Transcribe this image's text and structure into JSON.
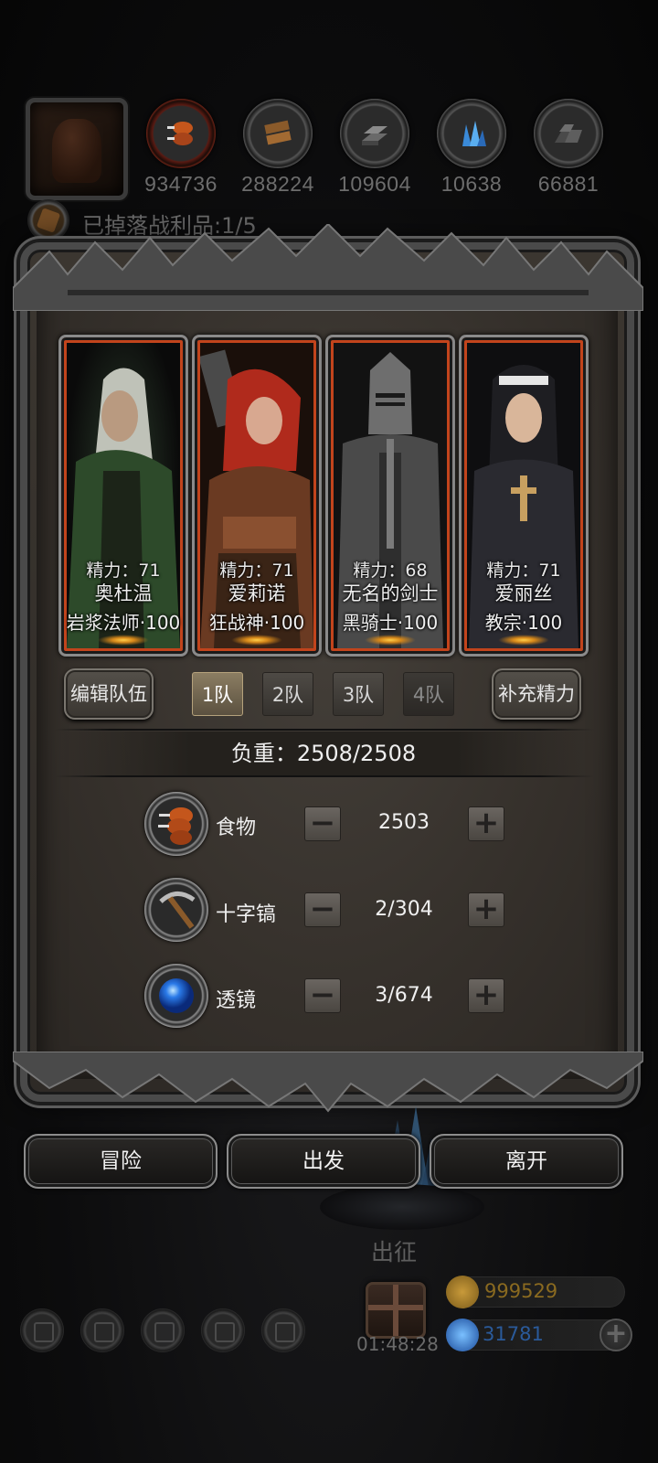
{
  "resources": [
    {
      "icon": "food-icon",
      "value": "934736"
    },
    {
      "icon": "wood-icon",
      "value": "288224"
    },
    {
      "icon": "iron-icon",
      "value": "109604"
    },
    {
      "icon": "crystal-icon",
      "value": "10638"
    },
    {
      "icon": "stone-icon",
      "value": "66881"
    }
  ],
  "loot": {
    "text": "已掉落战利品:1/5"
  },
  "heroes": [
    {
      "stamina": "精力：71",
      "name": "奥杜温",
      "class": "岩浆法师·100"
    },
    {
      "stamina": "精力：71",
      "name": "爱莉诺",
      "class": "狂战神·100"
    },
    {
      "stamina": "精力：68",
      "name": "无名的剑士",
      "class": "黑骑士·100"
    },
    {
      "stamina": "精力：71",
      "name": "爱丽丝",
      "class": "教宗·100"
    }
  ],
  "team": {
    "edit_label": "编辑队伍",
    "tabs": [
      "1队",
      "2队",
      "3队",
      "4队"
    ],
    "active_tab": "1队",
    "refill_label": "补充精力"
  },
  "weight": {
    "text": "负重：2508/2508"
  },
  "supplies": [
    {
      "icon": "food-icon",
      "label": "食物",
      "value": "2503"
    },
    {
      "icon": "pickaxe-icon",
      "label": "十字镐",
      "value": "2/304"
    },
    {
      "icon": "lens-icon",
      "label": "透镜",
      "value": "3/674"
    }
  ],
  "actions": {
    "adventure": "冒险",
    "depart": "出发",
    "leave": "离开"
  },
  "background": {
    "depart_label": "出征",
    "timer": "01:48:28"
  },
  "currency": {
    "gold": "999529",
    "gems": "31781"
  },
  "colors": {
    "card_glow": "#c2441c",
    "gold_text": "#8a6a20",
    "gem_text": "#2a5a9a"
  }
}
